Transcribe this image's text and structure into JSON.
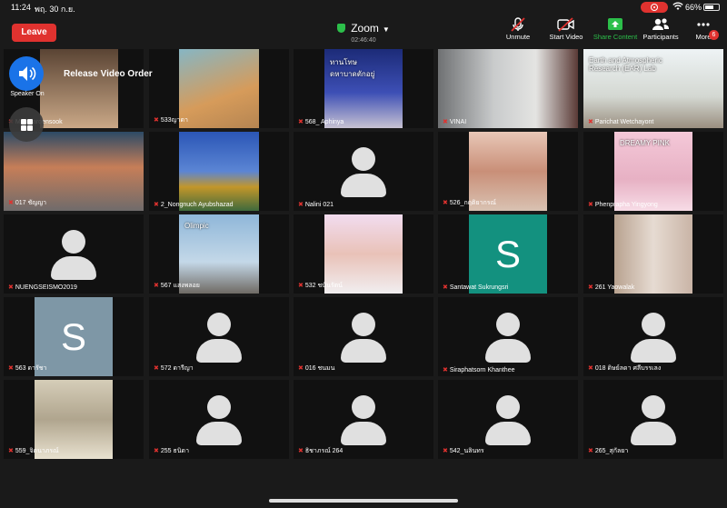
{
  "status": {
    "time": "11:24",
    "date": "พฤ. 30 ก.ย.",
    "battery_text": "66%",
    "battery_level": 0.66
  },
  "header": {
    "leave_label": "Leave",
    "meeting_title": "Zoom",
    "duration": "02:46:40"
  },
  "toolbar": [
    {
      "label": "Unmute",
      "icon": "muted-mic-icon"
    },
    {
      "label": "Start Video",
      "icon": "video-off-icon"
    },
    {
      "label": "Share Content",
      "icon": "share-content-icon",
      "color": "#2cbf4a"
    },
    {
      "label": "Participants",
      "icon": "participants-icon"
    },
    {
      "label": "More",
      "icon": "more-icon",
      "badge": "6"
    }
  ],
  "floating": {
    "speaker_label": "Speaker On",
    "release_label": "Release Video Order"
  },
  "participants": [
    {
      "name": "Manajaroensook",
      "kind": "video"
    },
    {
      "name": "533ญาดา",
      "kind": "video"
    },
    {
      "name": "568_ Aphinya",
      "kind": "video",
      "overlay_text": "ทานโทษ\nดหาบาดตักอยู่"
    },
    {
      "name": "VINAI",
      "kind": "video"
    },
    {
      "name": "Parichat Wetchayont",
      "kind": "video",
      "overlay_text": "Earth and Atmospheric\nResearch (EAR) Lab"
    },
    {
      "name": "017 ชัญญา",
      "kind": "video"
    },
    {
      "name": "2_Nongnuch Ayubshazad",
      "kind": "video"
    },
    {
      "name": "Nalini 021",
      "kind": "avatar"
    },
    {
      "name": "526_กฤติยากรณ์",
      "kind": "video"
    },
    {
      "name": "Phenprapha Yingyong",
      "kind": "video",
      "overlay_text": "DREAMY PINK"
    },
    {
      "name": "NUENGSEISMO2019",
      "kind": "avatar"
    },
    {
      "name": "567 แสงพลอย",
      "kind": "video",
      "overlay_text": "Olimpic"
    },
    {
      "name": "532 ชนันรัตน์",
      "kind": "video"
    },
    {
      "name": "Santawat Sukrungsri",
      "kind": "letter",
      "letter": "S"
    },
    {
      "name": "261 Yaowalak",
      "kind": "video"
    },
    {
      "name": "563 ดารัชา",
      "kind": "letter",
      "letter": "S"
    },
    {
      "name": "572 ดารีญา",
      "kind": "avatar"
    },
    {
      "name": "016 ชนมน",
      "kind": "avatar"
    },
    {
      "name": "Siraphatsorn Khanthee",
      "kind": "avatar"
    },
    {
      "name": "018 ดิษย์ลดา ศลีบรรเลง",
      "kind": "avatar"
    },
    {
      "name": "559_จิตนาภรณ์",
      "kind": "video"
    },
    {
      "name": "255 ธนิดา",
      "kind": "avatar"
    },
    {
      "name": "ธิชาภรณ์ 264",
      "kind": "avatar"
    },
    {
      "name": "542_นลินทร",
      "kind": "avatar"
    },
    {
      "name": "265_สุกัลยา",
      "kind": "avatar"
    }
  ],
  "colors": {
    "accent": "#e0322f",
    "share_green": "#2cbf4a",
    "speaker_blue": "#1a73e8",
    "letter_teal": "#13917f",
    "letter_slate": "#7e97a6"
  }
}
